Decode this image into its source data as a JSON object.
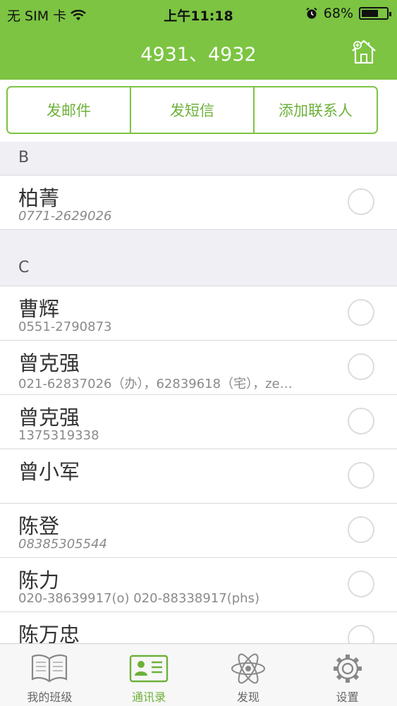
{
  "status_bar": {
    "carrier": "无 SIM 卡",
    "time": "上午11:18",
    "battery": "68%",
    "battery_level": 0.68
  },
  "nav": {
    "title": "4931、4932"
  },
  "actions": [
    {
      "label": "发邮件"
    },
    {
      "label": "发短信"
    },
    {
      "label": "添加联系人"
    }
  ],
  "sections": [
    {
      "header": "B",
      "contacts": [
        {
          "name": "柏菁",
          "phone": "0771-2629026",
          "italic": true
        }
      ]
    },
    {
      "header": "C",
      "contacts": [
        {
          "name": "曹辉",
          "phone": "0551-2790873",
          "italic": false
        },
        {
          "name": "曾克强",
          "phone": "021-62837026（办），62839618（宅），ze…",
          "italic": false
        },
        {
          "name": "曾克强",
          "phone": "1375319338",
          "italic": false
        },
        {
          "name": "曾小军",
          "phone": "",
          "italic": false
        },
        {
          "name": "陈登",
          "phone": " 08385305544",
          "italic": true
        },
        {
          "name": "陈力",
          "phone": "020-38639917(o) 020-88338917(phs)",
          "italic": false
        },
        {
          "name": "陈万忠",
          "phone": "",
          "italic": false
        }
      ]
    }
  ],
  "tabs": [
    {
      "label": "我的班级",
      "icon": "book-icon",
      "active": false
    },
    {
      "label": "通讯录",
      "icon": "contact-card-icon",
      "active": true
    },
    {
      "label": "发现",
      "icon": "atom-icon",
      "active": false
    },
    {
      "label": "设置",
      "icon": "gear-icon",
      "active": false
    }
  ],
  "colors": {
    "accent": "#7cc442",
    "accent_text": "#6db13a"
  }
}
